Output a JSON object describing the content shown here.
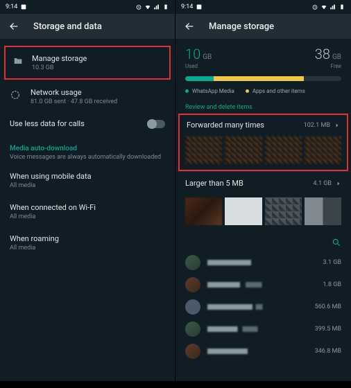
{
  "status": {
    "time": "9:14"
  },
  "left": {
    "header": "Storage and data",
    "manage_storage": {
      "title": "Manage storage",
      "sub": "10.3 GB"
    },
    "network": {
      "title": "Network usage",
      "sub": "81.0 GB sent · 47.8 GB received"
    },
    "use_less": "Use less data for calls",
    "auto_dl": {
      "header": "Media auto-download",
      "sub": "Voice messages are always automatically downloaded"
    },
    "mobile": {
      "title": "When using mobile data",
      "sub": "All media"
    },
    "wifi": {
      "title": "When connected on Wi-Fi",
      "sub": "All media"
    },
    "roaming": {
      "title": "When roaming",
      "sub": "All media"
    }
  },
  "right": {
    "header": "Manage storage",
    "used": {
      "num": "10",
      "unit": "GB",
      "label": "Used"
    },
    "free": {
      "num": "38",
      "unit": "GB",
      "label": "Free"
    },
    "legend": {
      "wa": "WhatsApp Media",
      "other": "Apps and other items"
    },
    "review": "Review and delete items",
    "forwarded": {
      "title": "Forwarded many times",
      "size": "102.1 MB"
    },
    "larger": {
      "title": "Larger than 5 MB",
      "size": "4.1 GB"
    },
    "chats": [
      {
        "size": "3.1 GB"
      },
      {
        "size": "1.8 GB"
      },
      {
        "size": "560.6 MB"
      },
      {
        "size": "399.5 MB"
      },
      {
        "size": "346.8 MB"
      }
    ]
  }
}
